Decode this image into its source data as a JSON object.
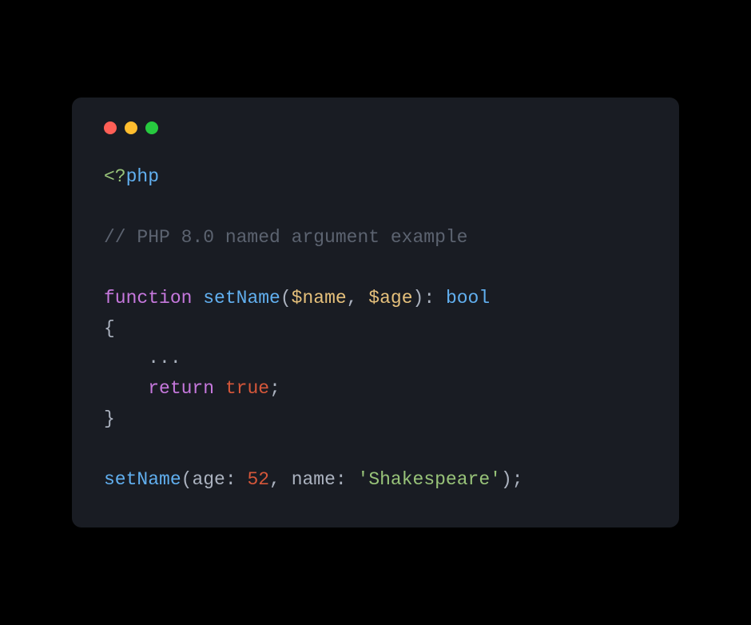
{
  "code": {
    "php_open": "<?",
    "php_tag": "php",
    "comment": "// PHP 8.0 named argument example",
    "fn_keyword": "function",
    "fn_name": "setName",
    "param1": "$name",
    "param2": "$age",
    "return_type": "bool",
    "open_brace": "{",
    "ellipsis": "...",
    "return_kw": "return",
    "return_val": "true",
    "close_brace": "}",
    "call_name": "setName",
    "arg1_name": "age",
    "arg1_val": "52",
    "arg2_name": "name",
    "arg2_val": "'Shakespeare'",
    "comma": ", ",
    "colon_sp": ": ",
    "semicolon": ";",
    "lparen": "(",
    "rparen": ")",
    "rparen_semi": ");"
  },
  "colors": {
    "background": "#000000",
    "editor_bg": "#191c23",
    "red": "#ff5f56",
    "yellow": "#ffbd2e",
    "green": "#27c93f"
  }
}
